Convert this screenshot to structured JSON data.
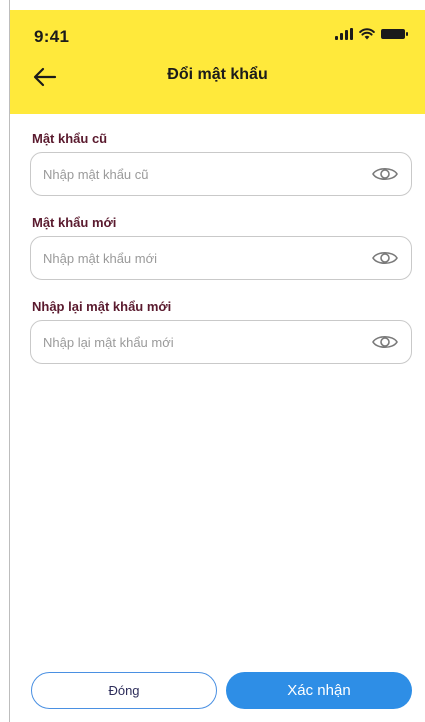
{
  "status_bar": {
    "time": "9:41",
    "signal_icon": "cellular-signal-icon",
    "wifi_icon": "wifi-icon",
    "battery_icon": "battery-icon"
  },
  "header": {
    "title": "Đổi mật khẩu",
    "back_icon": "arrow-left-icon",
    "background_color": "#ffe93b"
  },
  "form": {
    "old_password": {
      "label": "Mật khẩu cũ",
      "placeholder": "Nhập mật khẩu cũ",
      "value": ""
    },
    "new_password": {
      "label": "Mật khẩu mới",
      "placeholder": "Nhập mật khẩu mới",
      "value": ""
    },
    "confirm_password": {
      "label": "Nhập lại mật khẩu mới",
      "placeholder": "Nhập lại mật khẩu mới",
      "value": ""
    },
    "visibility_icon": "eye-icon"
  },
  "actions": {
    "close_label": "Đóng",
    "confirm_label": "Xác nhận",
    "confirm_color": "#2e8ee6"
  }
}
